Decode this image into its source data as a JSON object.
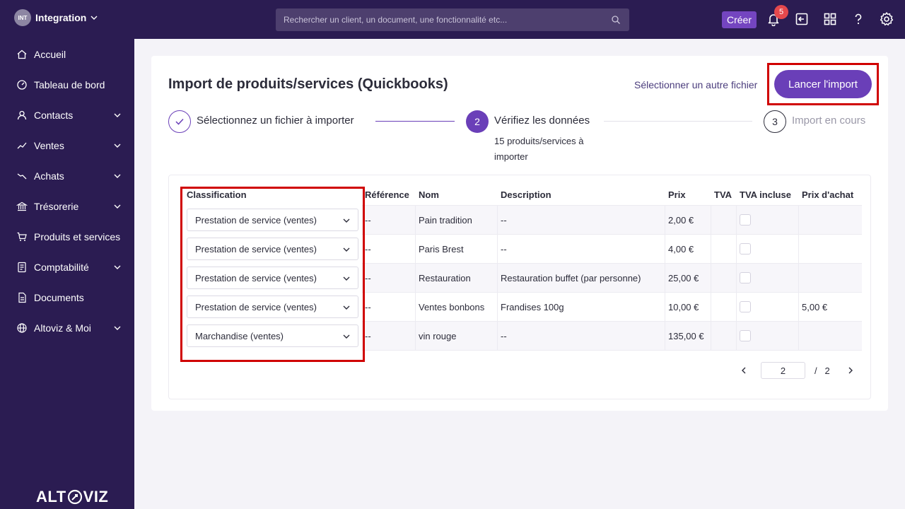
{
  "topbar": {
    "org_initials": "INT",
    "org_name": "Integration",
    "search_placeholder": "Rechercher un client, un document, une fonctionnalité etc...",
    "create_label": "Créer",
    "notification_count": "5"
  },
  "sidebar": {
    "items": [
      {
        "label": "Accueil",
        "icon": "home-icon"
      },
      {
        "label": "Tableau de bord",
        "icon": "dashboard-icon"
      },
      {
        "label": "Contacts",
        "icon": "user-icon"
      },
      {
        "label": "Ventes",
        "icon": "trend-up-icon"
      },
      {
        "label": "Achats",
        "icon": "trend-down-icon"
      },
      {
        "label": "Trésorerie",
        "icon": "bank-icon"
      },
      {
        "label": "Produits et services",
        "icon": "cart-icon"
      },
      {
        "label": "Comptabilité",
        "icon": "ledger-icon"
      },
      {
        "label": "Documents",
        "icon": "document-icon"
      },
      {
        "label": "Altoviz & Moi",
        "icon": "globe-icon"
      }
    ],
    "brand": {
      "left": "ALT",
      "right": "VIZ"
    }
  },
  "main": {
    "title": "Import de produits/services (Quickbooks)",
    "other_file_link": "Sélectionner un autre fichier",
    "launch_button": "Lancer l'import",
    "steps": [
      {
        "number": "",
        "label": "Sélectionnez un fichier à importer"
      },
      {
        "number": "2",
        "label": "Vérifiez les données",
        "sub": "15 produits/services à importer"
      },
      {
        "number": "3",
        "label": "Import en cours"
      }
    ],
    "table": {
      "headers": [
        "Classification",
        "Référence",
        "Nom",
        "Description",
        "Prix",
        "TVA",
        "TVA incluse",
        "Prix d'achat"
      ],
      "rows": [
        {
          "classification": "Prestation de service (ventes)",
          "reference": "--",
          "nom": "Pain tradition",
          "description": "--",
          "prix": "2,00 €",
          "tva": "",
          "prix_achat": ""
        },
        {
          "classification": "Prestation de service (ventes)",
          "reference": "--",
          "nom": "Paris Brest",
          "description": "--",
          "prix": "4,00 €",
          "tva": "",
          "prix_achat": ""
        },
        {
          "classification": "Prestation de service (ventes)",
          "reference": "--",
          "nom": "Restauration",
          "description": "Restauration buffet (par personne)",
          "prix": "25,00 €",
          "tva": "",
          "prix_achat": ""
        },
        {
          "classification": "Prestation de service (ventes)",
          "reference": "--",
          "nom": "Ventes bonbons",
          "description": "Frandises 100g",
          "prix": "10,00 €",
          "tva": "",
          "prix_achat": "5,00 €"
        },
        {
          "classification": "Marchandise (ventes)",
          "reference": "--",
          "nom": "vin rouge",
          "description": "--",
          "prix": "135,00 €",
          "tva": "",
          "prix_achat": ""
        }
      ]
    },
    "pager": {
      "current": "2",
      "separator": "/",
      "total": "2"
    }
  },
  "colors": {
    "accent": "#6a3fb8",
    "sidebar": "#2b1c52",
    "highlight": "#d00000"
  }
}
